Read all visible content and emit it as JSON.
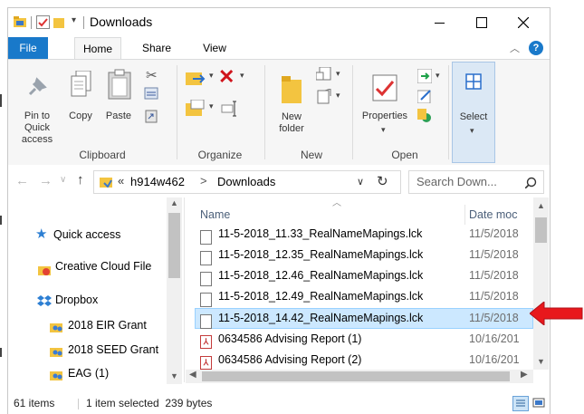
{
  "window": {
    "title": "Downloads"
  },
  "tabs": {
    "file": "File",
    "home": "Home",
    "share": "Share",
    "view": "View"
  },
  "ribbon": {
    "pin": "Pin to Quick access",
    "copy": "Copy",
    "paste": "Paste",
    "clipboard": "Clipboard",
    "organize": "Organize",
    "new_folder": "New folder",
    "new": "New",
    "properties": "Properties",
    "open": "Open",
    "select": "Select",
    "accent": "#2b579a"
  },
  "address": {
    "overflow": "«",
    "crumb1": "h914w462",
    "sep": ">",
    "crumb2": "Downloads",
    "search_placeholder": "Search Down..."
  },
  "nav": {
    "items": [
      {
        "label": "Quick access",
        "icon": "star-icon"
      },
      {
        "label": "Creative Cloud File",
        "icon": "creative-cloud-icon"
      },
      {
        "label": "Dropbox",
        "icon": "dropbox-icon"
      },
      {
        "label": "2018 EIR Grant",
        "icon": "shared-folder-icon"
      },
      {
        "label": "2018 SEED Grant",
        "icon": "shared-folder-icon"
      },
      {
        "label": "EAG (1)",
        "icon": "shared-folder-icon"
      }
    ]
  },
  "columns": {
    "name": "Name",
    "date": "Date moc"
  },
  "files": [
    {
      "name": "11-5-2018_11.33_RealNameMapings.lck",
      "date": "11/5/2018",
      "type": "doc"
    },
    {
      "name": "11-5-2018_12.35_RealNameMapings.lck",
      "date": "11/5/2018",
      "type": "doc"
    },
    {
      "name": "11-5-2018_12.46_RealNameMapings.lck",
      "date": "11/5/2018",
      "type": "doc"
    },
    {
      "name": "11-5-2018_12.49_RealNameMapings.lck",
      "date": "11/5/2018",
      "type": "doc"
    },
    {
      "name": "11-5-2018_14.42_RealNameMapings.lck",
      "date": "11/5/2018",
      "type": "doc",
      "selected": true
    },
    {
      "name": "0634586 Advising Report (1)",
      "date": "10/16/201",
      "type": "pdf"
    },
    {
      "name": "0634586 Advising Report (2)",
      "date": "10/16/201",
      "type": "pdf"
    }
  ],
  "status": {
    "count": "61 items",
    "selection": "1 item selected  239 bytes"
  },
  "colors": {
    "selection": "#cce8ff",
    "selection_border": "#99d1ff",
    "arrow": "#e8181c"
  }
}
